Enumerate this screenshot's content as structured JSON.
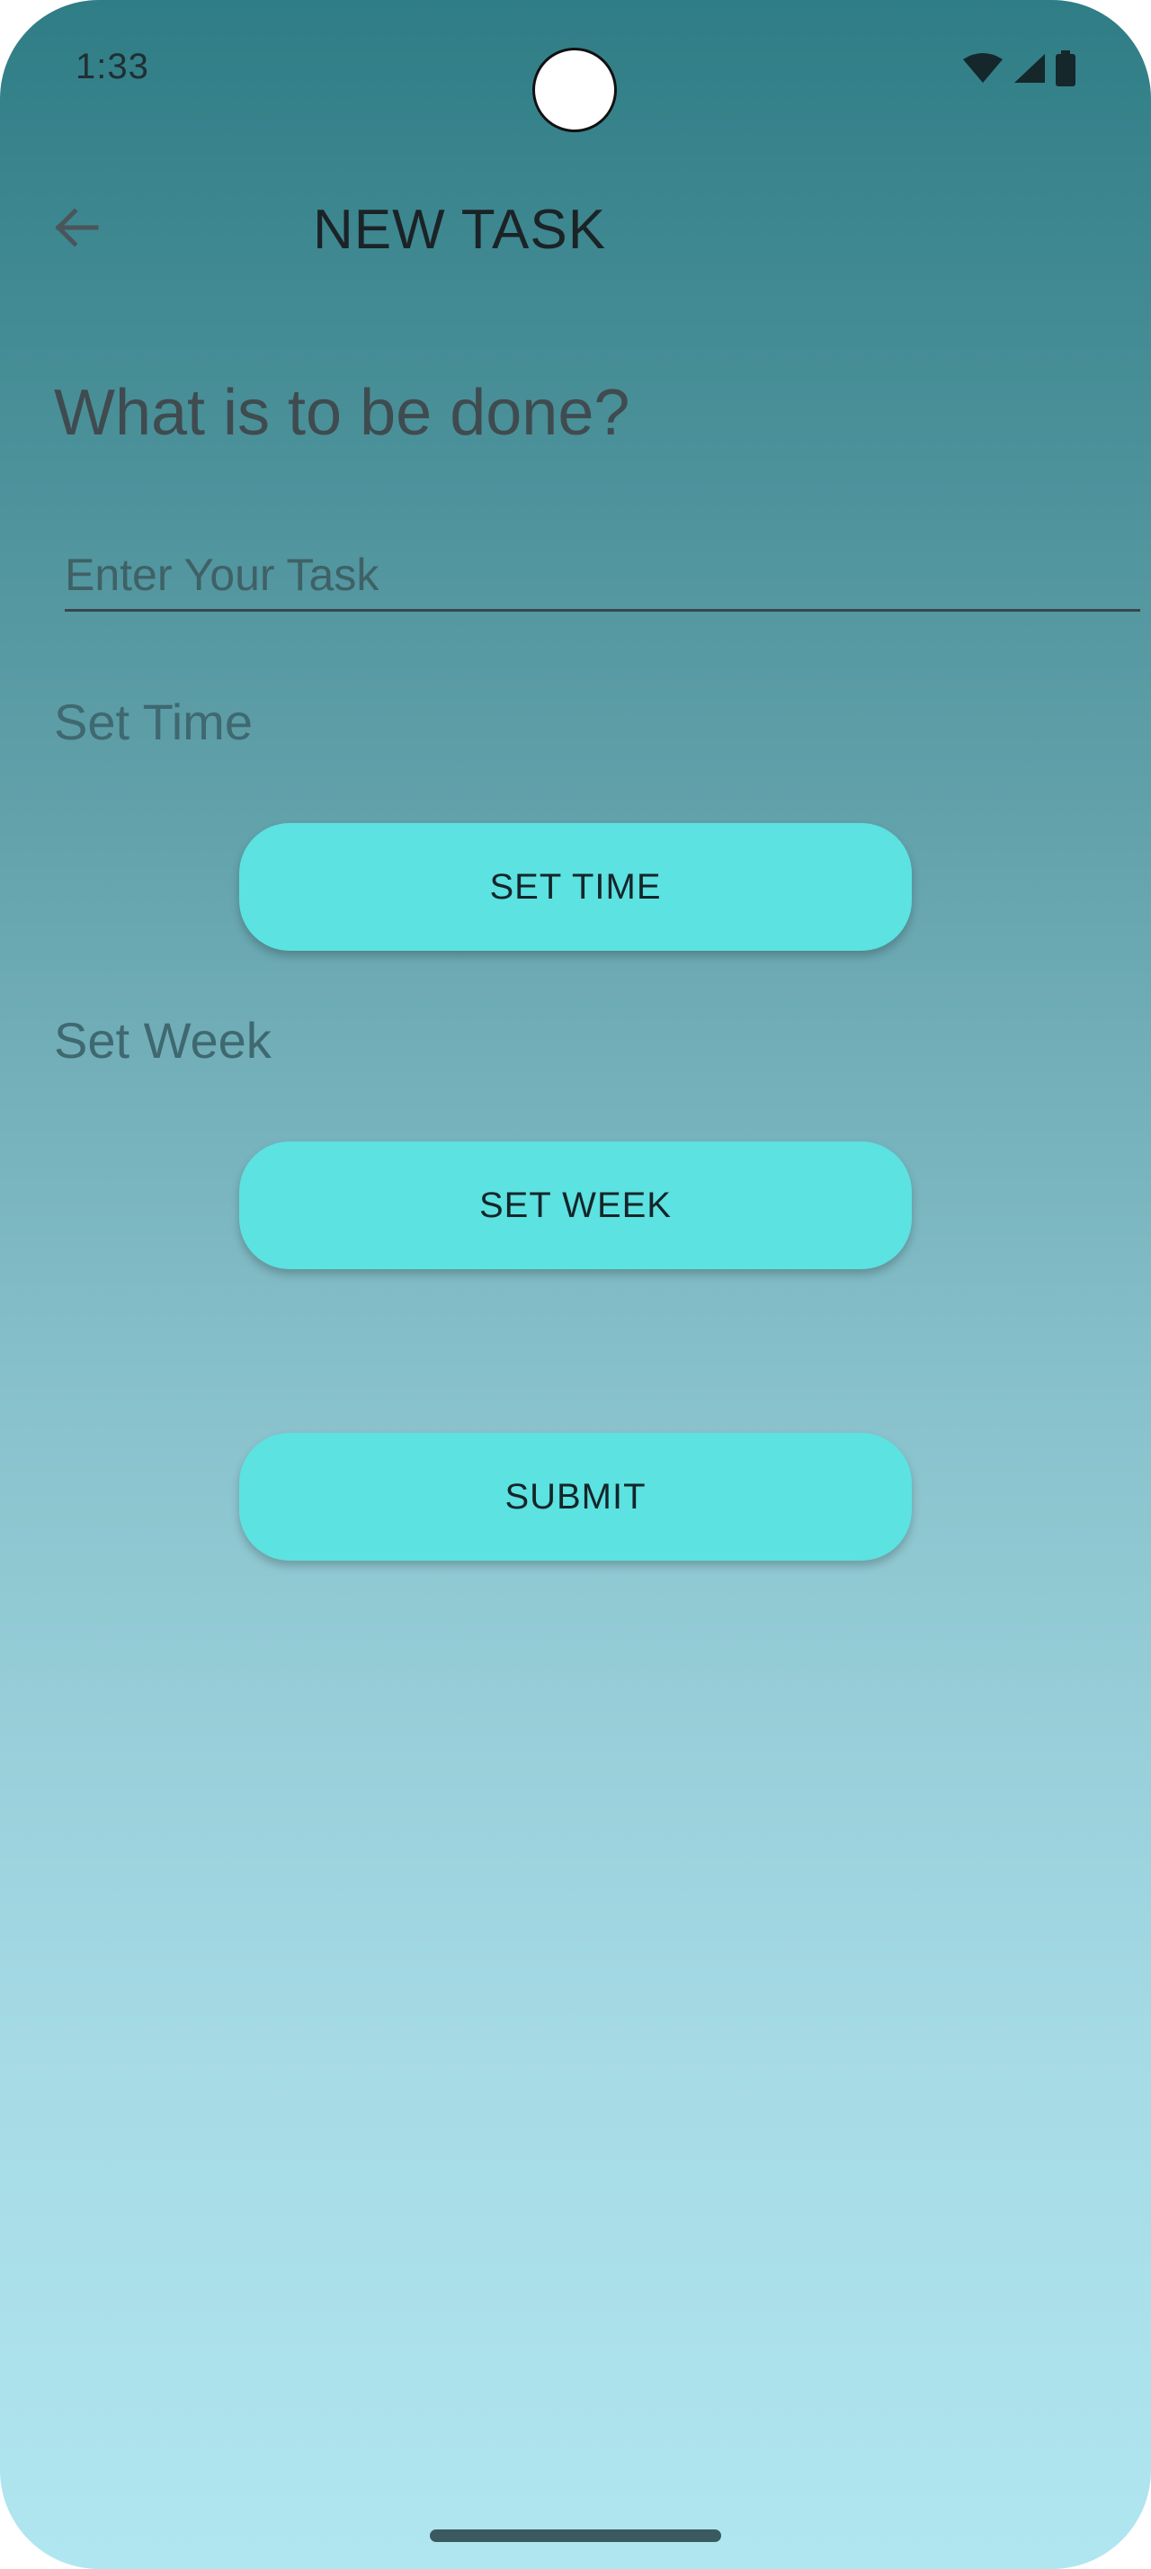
{
  "status_bar": {
    "time": "1:33",
    "icons": [
      "wifi-icon",
      "cellular-signal-icon",
      "battery-icon"
    ]
  },
  "app_bar": {
    "back_icon": "arrow-back-icon",
    "title": "NEW TASK"
  },
  "form": {
    "question": "What is to be done?",
    "task_input": {
      "value": "",
      "placeholder": "Enter Your Task"
    },
    "set_time_label": "Set Time",
    "set_time_button": "SET TIME",
    "set_week_label": "Set Week",
    "set_week_button": "SET WEEK",
    "submit_button": "SUBMIT"
  },
  "colors": {
    "gradient_top": "#2f7d86",
    "gradient_bottom": "#b0e6f0",
    "button_fill": "#5ce2e0"
  }
}
